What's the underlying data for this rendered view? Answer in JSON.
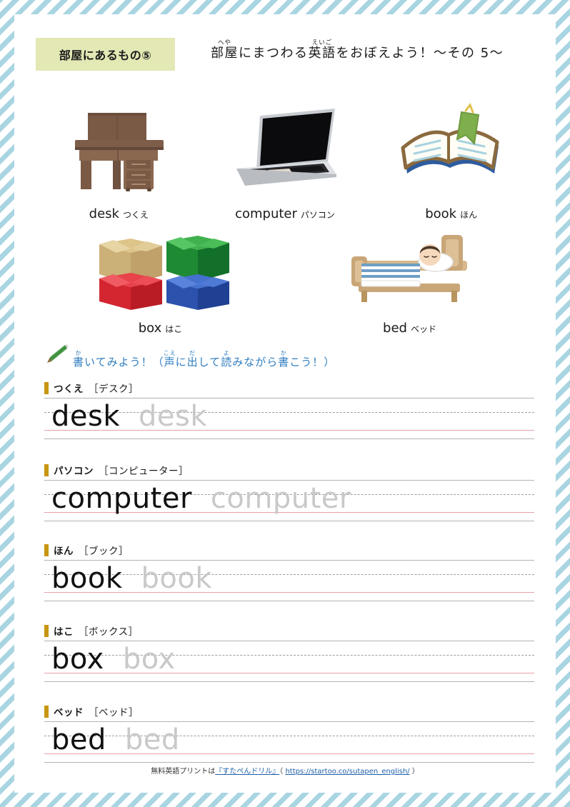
{
  "header": {
    "ribbon_label": "部屋にあるもの⑤",
    "title_parts": [
      {
        "base": "部屋",
        "ruby": "へや"
      },
      {
        "base": "にまつわる",
        "ruby": ""
      },
      {
        "base": "英語",
        "ruby": "えいご"
      },
      {
        "base": "をおぼえよう！～その5～",
        "ruby": ""
      }
    ],
    "title_plain": "部屋にまつわる英語をおぼえよう！～その5～"
  },
  "pictures": [
    {
      "icon": "desk-icon",
      "en": "desk",
      "jp": "つくえ"
    },
    {
      "icon": "laptop-icon",
      "en": "computer",
      "jp": "パソコン"
    },
    {
      "icon": "book-icon",
      "en": "book",
      "jp": "ほん"
    },
    {
      "icon": "boxes-icon",
      "en": "box",
      "jp": "はこ"
    },
    {
      "icon": "bed-icon",
      "en": "bed",
      "jp": "ベッド"
    }
  ],
  "write_prompt": {
    "icon": "pencil-icon",
    "parts": [
      {
        "base": "書",
        "ruby": "か"
      },
      {
        "base": "いてみよう！（",
        "ruby": ""
      },
      {
        "base": "声",
        "ruby": "こえ"
      },
      {
        "base": "に",
        "ruby": ""
      },
      {
        "base": "出",
        "ruby": "だ"
      },
      {
        "base": "して",
        "ruby": ""
      },
      {
        "base": "読",
        "ruby": "よ"
      },
      {
        "base": "みながら",
        "ruby": ""
      },
      {
        "base": "書",
        "ruby": "か"
      },
      {
        "base": "こう！）",
        "ruby": ""
      }
    ],
    "plain": "書いてみよう！（声に出して読みながら書こう！）"
  },
  "practice": [
    {
      "kana": "つくえ",
      "bracket": "［デスク］",
      "word": "desk",
      "trace": "desk"
    },
    {
      "kana": "パソコン",
      "bracket": "［コンピューター］",
      "word": "computer",
      "trace": "computer"
    },
    {
      "kana": "ほん",
      "bracket": "［ブック］",
      "word": "book",
      "trace": "book"
    },
    {
      "kana": "はこ",
      "bracket": "［ボックス］",
      "word": "box",
      "trace": "box"
    },
    {
      "kana": "ベッド",
      "bracket": "［ベッド］",
      "word": "bed",
      "trace": "bed"
    }
  ],
  "footer": {
    "prefix": "無料英語プリントは",
    "site": "『すたぺんドリル』",
    "paren_open": "（ ",
    "url": "https://startoo.co/sutapen_english/",
    "paren_close": " ）"
  },
  "colors": {
    "border_stripe": "#a9d5e2",
    "ribbon": "#e3e8b4",
    "marker_bar": "#c8950f",
    "prompt_text": "#2f7dc0",
    "baseline": "#e8a0aa",
    "ghost_text": "#c9c9c9",
    "link": "#1f5fa8"
  }
}
